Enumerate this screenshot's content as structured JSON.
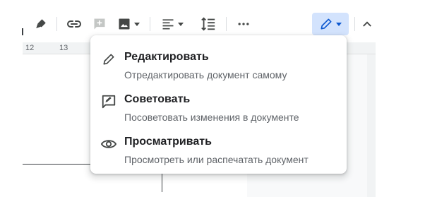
{
  "toolbar": {
    "buttons": [
      {
        "id": "paint-format",
        "icon": "paint-format-icon"
      },
      {
        "id": "insert-link",
        "icon": "link-icon"
      },
      {
        "id": "add-comment",
        "icon": "add-comment-icon"
      },
      {
        "id": "insert-image",
        "icon": "image-icon"
      },
      {
        "id": "align",
        "icon": "align-left-icon"
      },
      {
        "id": "line-spacing",
        "icon": "line-spacing-icon"
      },
      {
        "id": "more",
        "icon": "more-horiz-icon"
      }
    ],
    "mode_icon": "pencil-icon",
    "collapse_icon": "chevron-up-icon",
    "accent_color": "#0b57d0",
    "mode_bg_color": "#d3e3fd"
  },
  "ruler": {
    "ticks": [
      "12",
      "13"
    ]
  },
  "mode_menu": {
    "items": [
      {
        "icon": "pencil-icon",
        "title": "Редактировать",
        "subtitle": "Отредактировать документ самому"
      },
      {
        "icon": "suggest-icon",
        "title": "Советовать",
        "subtitle": "Посоветовать изменения в документе"
      },
      {
        "icon": "eye-icon",
        "title": "Просматривать",
        "subtitle": "Просмотреть или распечатать документ"
      }
    ]
  }
}
